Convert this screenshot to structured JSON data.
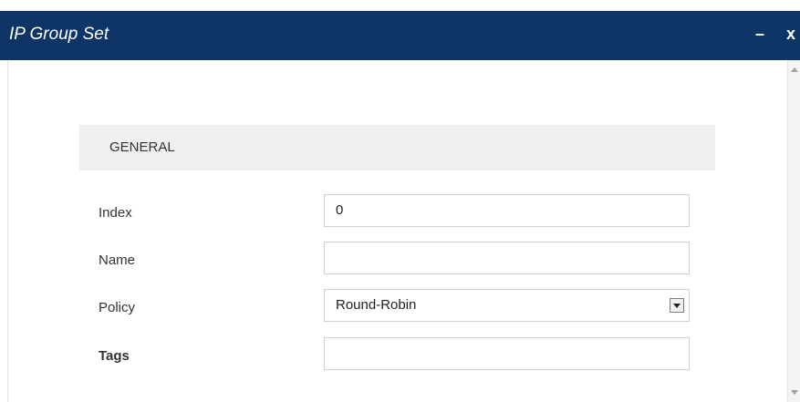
{
  "window": {
    "title": "IP Group Set",
    "minimize_label": "–",
    "close_label": "x"
  },
  "section": {
    "title": "GENERAL"
  },
  "fields": {
    "index": {
      "label": "Index",
      "value": "0"
    },
    "name": {
      "label": "Name",
      "value": ""
    },
    "policy": {
      "label": "Policy",
      "value": "Round-Robin"
    },
    "tags": {
      "label": "Tags",
      "value": ""
    }
  },
  "colors": {
    "titlebar": "#0f3566",
    "section_bg": "#efefef"
  }
}
